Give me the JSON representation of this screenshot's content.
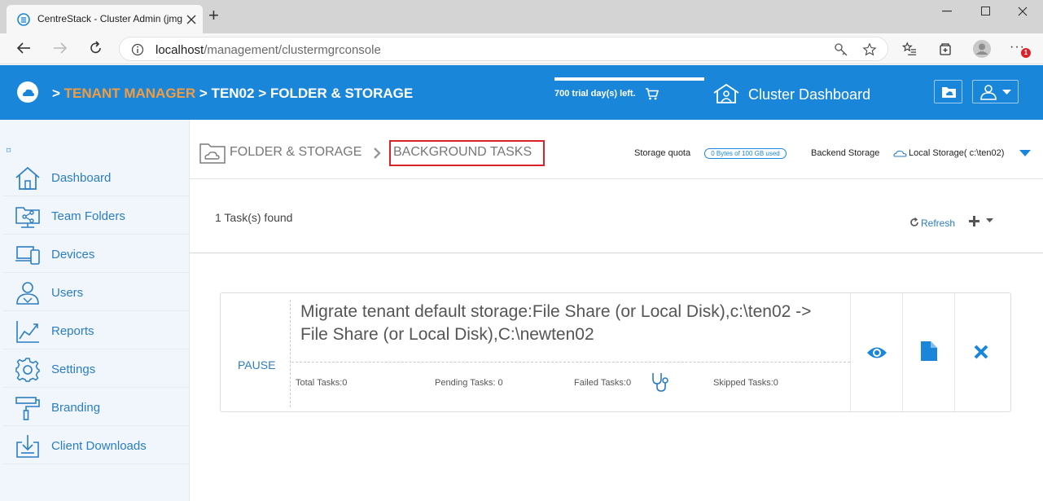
{
  "browser": {
    "tab_title": "CentreStack - Cluster Admin (jmg",
    "new_tab_symbol": "+",
    "url_host": "localhost",
    "url_path": "/management/clustermgrconsole",
    "notification_count": "1"
  },
  "header": {
    "crumb_prefix": ">",
    "crumb_tenant_manager": "TENANT MANAGER",
    "crumb_ten02": "> TEN02",
    "crumb_folder_storage": "> FOLDER & STORAGE",
    "trial_text": "700 trial day(s) left.",
    "cluster_dashboard": "Cluster Dashboard"
  },
  "sidebar": {
    "collapse_symbol": "⌑",
    "items": [
      {
        "label": "Dashboard",
        "icon": "home-icon"
      },
      {
        "label": "Team Folders",
        "icon": "team-folder-icon"
      },
      {
        "label": "Devices",
        "icon": "devices-icon"
      },
      {
        "label": "Users",
        "icon": "users-icon"
      },
      {
        "label": "Reports",
        "icon": "reports-icon"
      },
      {
        "label": "Settings",
        "icon": "gear-icon"
      },
      {
        "label": "Branding",
        "icon": "paint-roller-icon"
      },
      {
        "label": "Client Downloads",
        "icon": "download-icon"
      }
    ]
  },
  "main": {
    "breadcrumb_folder": "FOLDER & STORAGE",
    "breadcrumb_separator": "›",
    "breadcrumb_current": "BACKGROUND TASKS",
    "storage_quota_label": "Storage quota",
    "storage_quota_value": "0 Bytes of 100 GB used",
    "backend_storage_label": "Backend Storage",
    "backend_storage_value": "Local Storage( c:\\ten02)",
    "tasks_found": "1 Task(s) found",
    "refresh_label": "Refresh"
  },
  "task": {
    "pause_label": "PAUSE",
    "title": "Migrate tenant default storage:File Share (or Local Disk),c:\\ten02 -> File Share (or Local Disk),C:\\newten02",
    "total_tasks": "Total Tasks:0",
    "pending_tasks": "Pending Tasks: 0",
    "failed_tasks": "Failed Tasks:0",
    "skipped_tasks": "Skipped Tasks:0"
  },
  "colors": {
    "brand_blue": "#1a86d9",
    "accent_orange": "#f39c3f",
    "highlight_red": "#d9232b"
  }
}
